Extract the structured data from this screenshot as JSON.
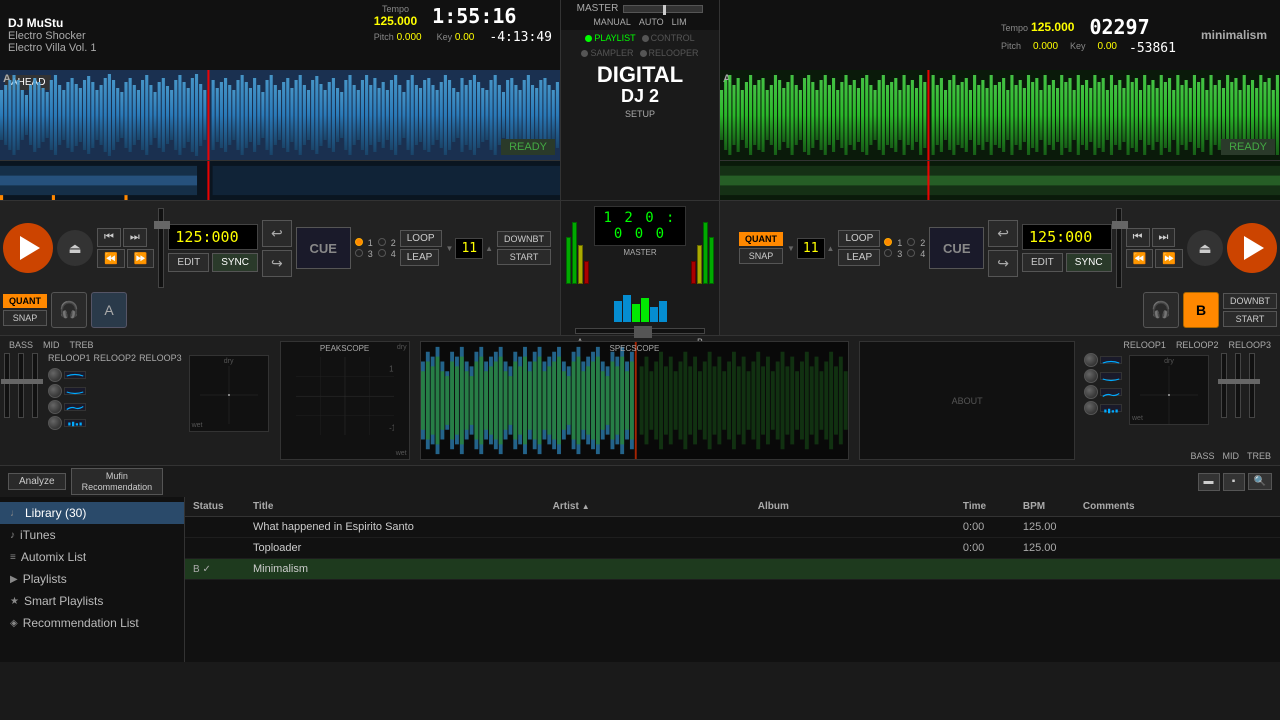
{
  "leftDeck": {
    "djName": "DJ MuStu",
    "trackName": "Electro Shocker",
    "album": "Electro Villa Vol. 1",
    "tempoLabel": "Tempo",
    "tempoValue": "125.000",
    "pitchLabel": "Pitch",
    "pitchValue": "0.000",
    "keyLabel": "Key",
    "keyValue": "0.00",
    "timeDisplay": "1:55:16",
    "timeRemaining": "-4:13:49",
    "aheadLabel": "AHEAD",
    "readyLabel": "READY",
    "markerLabel": "A",
    "cueLabel": "CUE",
    "editLabel": "EDIT",
    "syncLabel": "SYNC",
    "loopLabel": "LOOP",
    "leapLabel": "LEAP",
    "downbtLabel": "DOWNBT",
    "startLabel": "START",
    "quantLabel": "QUANT",
    "snapLabel": "SNAP",
    "bpmDisplay": "125:000",
    "loopNum": "11",
    "radio1": "1",
    "radio2": "2",
    "radio3": "3",
    "radio4": "4"
  },
  "rightDeck": {
    "trackName": "minimalism",
    "tempoLabel": "Tempo",
    "tempoValue": "125.000",
    "pitchLabel": "Pitch",
    "pitchValue": "0.000",
    "keyLabel": "Key",
    "keyValue": "0.00",
    "timeDisplay": "02297",
    "timeRemaining": "-53861",
    "readyLabel": "READY",
    "markerLabel": "A",
    "cueLabel": "CUE",
    "editLabel": "EDIT",
    "syncLabel": "SYNC",
    "loopLabel": "LOOP",
    "leapLabel": "LEAP",
    "downbtLabel": "DOWNBT",
    "startLabel": "START",
    "quantLabel": "QUANT",
    "snapLabel": "SNAP",
    "bpmDisplay": "125:000",
    "loopNum": "11"
  },
  "centerMixer": {
    "masterLabel": "MASTER",
    "manualLabel": "MANUAL",
    "autoLabel": "AUTO",
    "limLabel": "LIM",
    "playlistLabel": "PLAYLIST",
    "controlLabel": "CONTROL",
    "samplerLabel": "SAMPLER",
    "relooperLabel": "RELOOPER",
    "digitalDJLabel": "DIGITAL",
    "djNumLabel": "DJ 2",
    "setupLabel": "SETUP",
    "masterTimeDisplay": "1 2 0 : 0 0 0",
    "masterBpmLabel": "MASTER"
  },
  "effectsSection": {
    "bassLabel": "BASS",
    "midLabel": "MID",
    "trebLabel": "TREB",
    "reloop1Label": "RELOOP1",
    "reloop2Label": "RELOOP2",
    "reloop3Label": "RELOOP3",
    "peakscopeLabel": "PEAKSCOPE",
    "specsscopeLabel": "SPECSCOPE",
    "aboutLabel": "ABOUT"
  },
  "library": {
    "tabBar": {
      "analyzeBtn": "Analyze",
      "muffinBtn": "Mufin\nRecommendation"
    },
    "tableHeaders": {
      "status": "Status",
      "title": "Title",
      "artist": "Artist",
      "album": "Album",
      "time": "Time",
      "bpm": "BPM",
      "comments": "Comments"
    },
    "rows": [
      {
        "status": "",
        "title": "What happened in Espirito Santo",
        "artist": "",
        "album": "",
        "time": "0:00",
        "bpm": "125.00",
        "comments": ""
      },
      {
        "status": "",
        "title": "Toploader",
        "artist": "",
        "album": "",
        "time": "0:00",
        "bpm": "125.00",
        "comments": ""
      },
      {
        "status": "B ✓",
        "title": "Minimalism",
        "artist": "",
        "album": "",
        "time": "",
        "bpm": "",
        "comments": ""
      }
    ]
  },
  "sidebar": {
    "items": [
      {
        "icon": "♩",
        "label": "Library (30)",
        "active": true
      },
      {
        "icon": "♪",
        "label": "iTunes",
        "active": false
      },
      {
        "icon": "≡",
        "label": "Automix List",
        "active": false
      },
      {
        "icon": "▶",
        "label": "Playlists",
        "active": false
      },
      {
        "icon": "★",
        "label": "Smart Playlists",
        "active": false
      },
      {
        "icon": "◈",
        "label": "Recommendation List",
        "active": false
      }
    ]
  },
  "icons": {
    "playIcon": "▶",
    "ejectIcon": "⏏",
    "prevIcon": "⏮",
    "nextIcon": "⏭",
    "rewindIcon": "⏪",
    "ffIcon": "⏩",
    "headphoneIcon": "🎧",
    "loopIcon": "↩",
    "skipBackIcon": "↺",
    "searchIcon": "🔍"
  }
}
